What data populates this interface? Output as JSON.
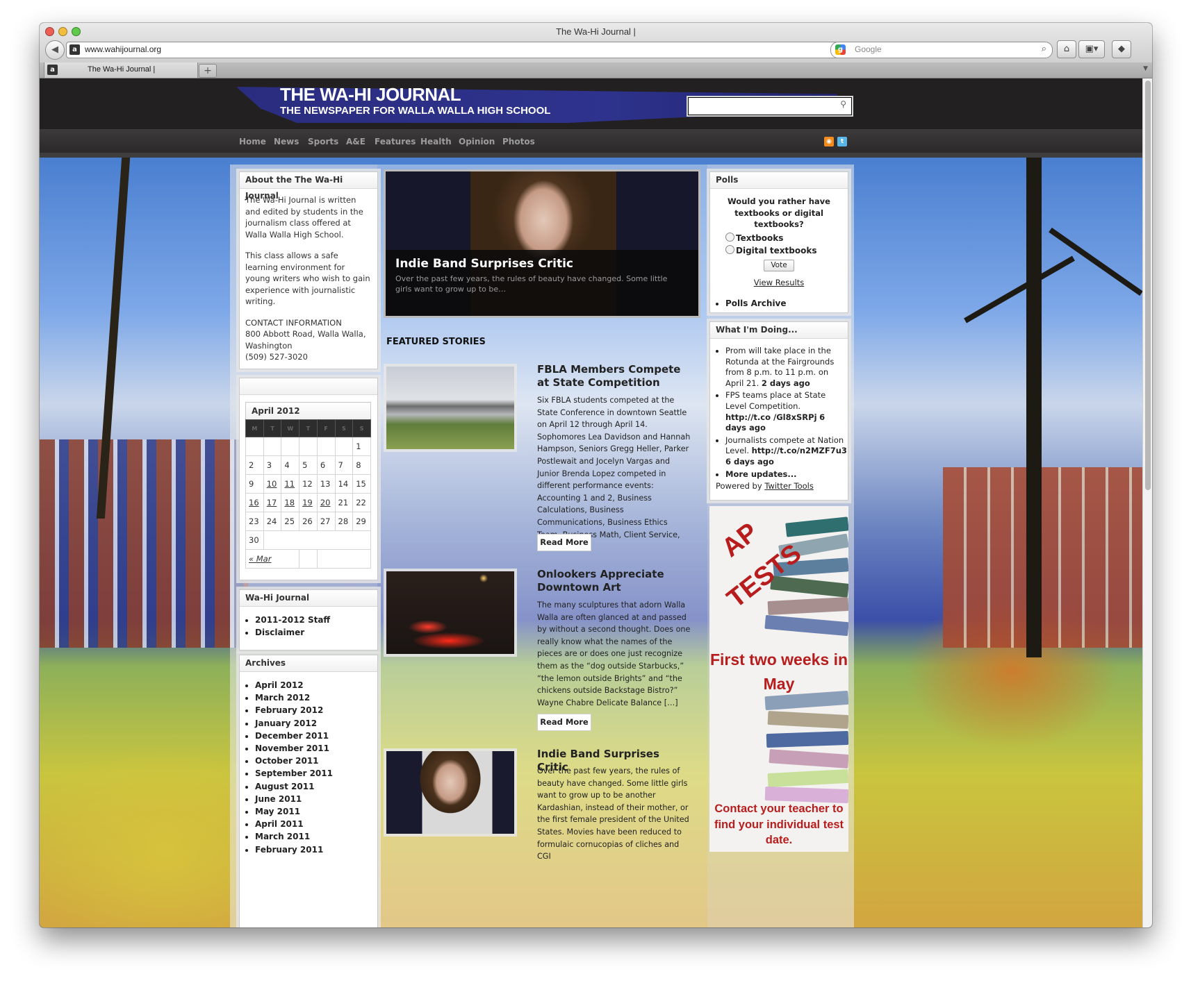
{
  "window": {
    "title": "The Wa-Hi Journal |"
  },
  "browser": {
    "url": "www.wahijournal.org",
    "search_placeholder": "Google",
    "tab_label": "The Wa-Hi Journal |",
    "new_tab": "+"
  },
  "site": {
    "title": "THE WA-HI JOURNAL",
    "subtitle": "THE NEWSPAPER FOR WALLA WALLA HIGH SCHOOL",
    "nav": [
      "Home",
      "News",
      "Sports",
      "A&E",
      "Features",
      "Health",
      "Opinion",
      "Photos"
    ]
  },
  "about": {
    "title": "About the The Wa-Hi Journal",
    "p1": "The Wa-Hi Journal is written and edited by students in the journalism class offered at Walla Walla High School.",
    "p2": "This class allows a safe learning environment for young writers who wish to gain experience with journalistic writing.",
    "contact_h": "CONTACT INFORMATION",
    "address1": "800 Abbott Road, Walla Walla,",
    "address2": "Washington",
    "phone": "(509) 527-3020"
  },
  "calendar": {
    "caption": "April 2012",
    "weeks": [
      [
        "",
        "",
        "",
        "",
        "",
        "",
        "1"
      ],
      [
        "2",
        "3",
        "4",
        "5",
        "6",
        "7",
        "8"
      ],
      [
        "9",
        "10",
        "11",
        "12",
        "13",
        "14",
        "15"
      ],
      [
        "16",
        "17",
        "18",
        "19",
        "20",
        "21",
        "22"
      ],
      [
        "23",
        "24",
        "25",
        "26",
        "27",
        "28",
        "29"
      ],
      [
        "30",
        "",
        "",
        "",
        "",
        "",
        ""
      ]
    ],
    "prev": "« Mar"
  },
  "wahi_links": {
    "title": "Wa-Hi Journal",
    "items": [
      "2011-2012 Staff",
      "Disclaimer"
    ]
  },
  "archives": {
    "title": "Archives",
    "items": [
      "April 2012",
      "March 2012",
      "February 2012",
      "January 2012",
      "December 2011",
      "November 2011",
      "October 2011",
      "September 2011",
      "August 2011",
      "June 2011",
      "May 2011",
      "April 2011",
      "March 2011",
      "February 2011"
    ]
  },
  "slider": {
    "title": "Indie Band Surprises Critic",
    "text": "Over the past few years, the rules of beauty have changed. Some little girls want to grow up to be…"
  },
  "featured_heading": "FEATURED STORIES",
  "stories": [
    {
      "title": "FBLA Members Compete at State Competition",
      "text": "Six FBLA students competed at the State Conference in downtown Seattle on April 12 through April 14. Sophomores Lea Davidson and Hannah Hampson, Seniors Gregg Heller, Parker Postlewait and Jocelyn Vargas and Junior Brenda Lopez competed in different performance events: Accounting 1 and 2, Business Calculations, Business Communications, Business Ethics Team, Business Math, Client Service, […]",
      "more": "Read More"
    },
    {
      "title": "Onlookers Appreciate Downtown Art",
      "text": "The many sculptures that adorn Walla Walla are often glanced at and passed by without a second thought. Does one really know what the names of the pieces are or does one just recognize them as the “dog outside Starbucks,” “the lemon outside Brights” and “the chickens outside Backstage Bistro?” Wayne Chabre Delicate Balance   […]",
      "more": "Read More"
    },
    {
      "title": "Indie Band Surprises Critic",
      "text": "Over the past few years, the rules of beauty have changed. Some little girls want to grow up to be another Kardashian, instead of their mother, or the first female president of the United States. Movies have been reduced to formulaic cornucopias of cliches and CGI",
      "more": ""
    }
  ],
  "polls": {
    "title": "Polls",
    "question": "Would you rather have textbooks or digital textbooks?",
    "options": [
      "Textbooks",
      "Digital textbooks"
    ],
    "vote": "Vote",
    "view_results": "View Results",
    "archive": "Polls Archive"
  },
  "doing": {
    "title": "What I'm Doing...",
    "t1_text": "Prom will take place in the Rotunda at the Fairgrounds from 8 p.m. to 11 p.m. on April 21.",
    "t1_time": "2 days ago",
    "t2_text": "FPS teams place at State Level Competition.",
    "t2_link": "http://t.co /Gl8xSRPj",
    "t2_time": "6 days ago",
    "t3_text": "Journalists compete at Nation Level.",
    "t3_link": "http://t.co/n2MZF7u3",
    "t3_time": "6 days ago",
    "more": "More updates...",
    "powered": "Powered by",
    "powered_link": "Twitter Tools"
  },
  "ad": {
    "ap": "AP",
    "tests": "TESTS",
    "line1": "First two weeks in May",
    "line2": "Contact your teacher to find your individual test date."
  }
}
